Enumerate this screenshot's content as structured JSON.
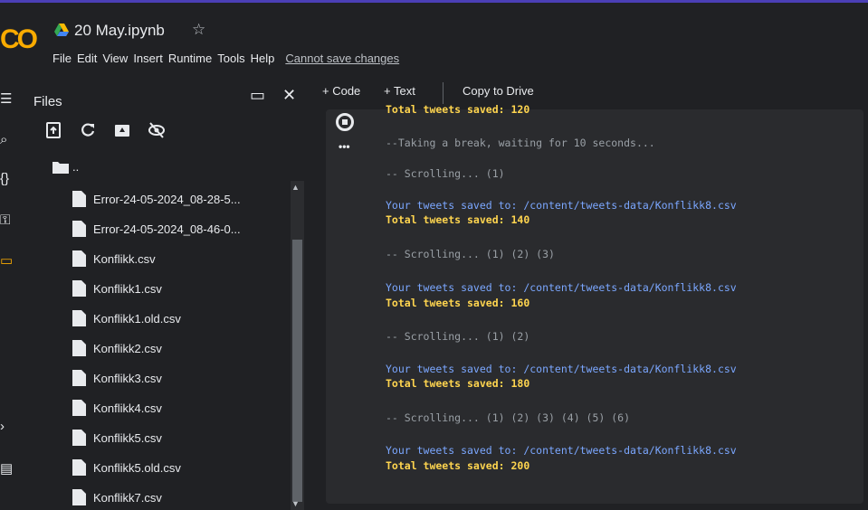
{
  "header": {
    "logo": "CO",
    "title": "20 May.ipynb",
    "menu": [
      "File",
      "Edit",
      "View",
      "Insert",
      "Runtime",
      "Tools",
      "Help"
    ],
    "save_notice": "Cannot save changes"
  },
  "files_panel": {
    "title": "Files",
    "folder_label": "..",
    "files": [
      "Error-24-05-2024_08-28-5...",
      "Error-24-05-2024_08-46-0...",
      "Konflikk.csv",
      "Konflikk1.csv",
      "Konflikk1.old.csv",
      "Konflikk2.csv",
      "Konflikk3.csv",
      "Konflikk4.csv",
      "Konflikk5.csv",
      "Konflikk5.old.csv",
      "Konflikk7.csv"
    ]
  },
  "toolbar": {
    "code": "+ Code",
    "text": "+ Text",
    "copy": "Copy to Drive"
  },
  "output": {
    "top_cut": "Total tweets saved: 120",
    "lines": [
      {
        "text": "--Taking a break, waiting for 10 seconds...",
        "kind": "gray"
      },
      {
        "text": "-- Scrolling... (1)",
        "kind": "gray"
      },
      {
        "text": "Your tweets saved to: /content/tweets-data/Konflikk8.csv",
        "kind": "blue"
      },
      {
        "text": "Total tweets saved: 140",
        "kind": "yellow"
      },
      {
        "text": "-- Scrolling... (1) (2) (3)",
        "kind": "gray"
      },
      {
        "text": "Your tweets saved to: /content/tweets-data/Konflikk8.csv",
        "kind": "blue"
      },
      {
        "text": "Total tweets saved: 160",
        "kind": "yellow"
      },
      {
        "text": "-- Scrolling... (1) (2)",
        "kind": "gray"
      },
      {
        "text": "Your tweets saved to: /content/tweets-data/Konflikk8.csv",
        "kind": "blue"
      },
      {
        "text": "Total tweets saved: 180",
        "kind": "yellow"
      },
      {
        "text": "-- Scrolling... (1) (2) (3) (4) (5) (6)",
        "kind": "gray"
      },
      {
        "text": "Your tweets saved to: /content/tweets-data/Konflikk8.csv",
        "kind": "blue"
      },
      {
        "text": "Total tweets saved: 200",
        "kind": "yellow"
      }
    ]
  },
  "colors": {
    "accent_line": "#4b3fb6",
    "output_blue": "#7ba7ff",
    "output_yellow": "#ffd54f"
  }
}
